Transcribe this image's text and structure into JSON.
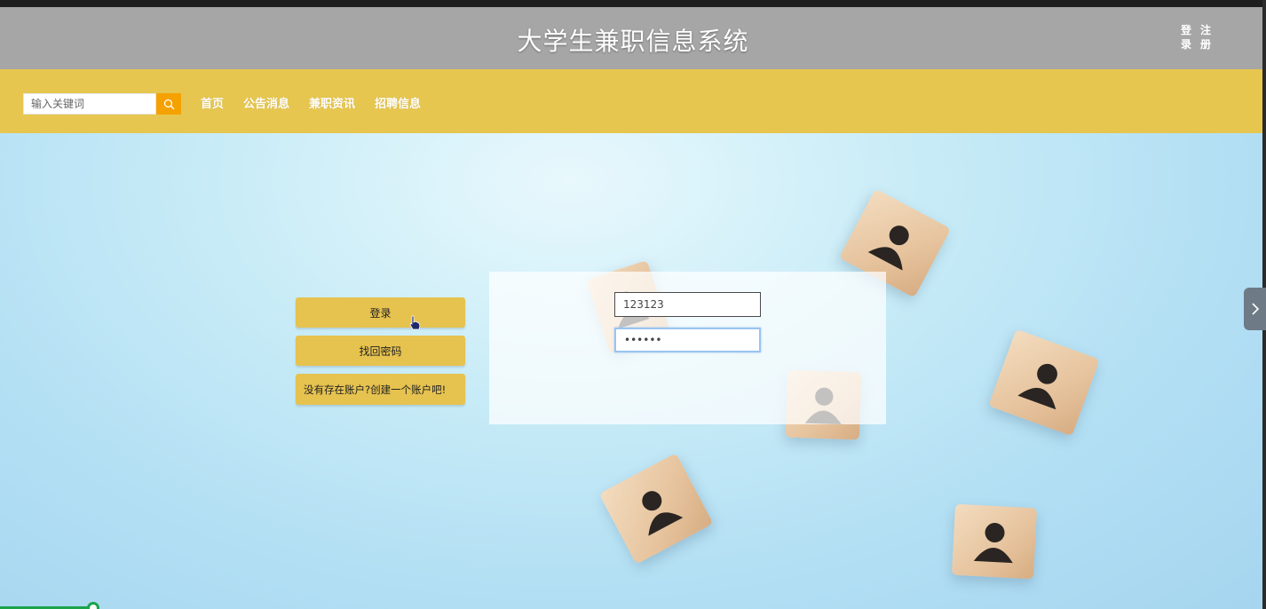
{
  "header": {
    "title": "大学生兼职信息系统",
    "login_link": "登录",
    "register_link": "注册"
  },
  "nav": {
    "search_placeholder": "输入关键词",
    "items": [
      "首页",
      "公告消息",
      "兼职资讯",
      "招聘信息"
    ]
  },
  "login": {
    "login_button": "登录",
    "forgot_button": "找回密码",
    "register_button": "没有存在账户?创建一个账户吧!",
    "username_value": "123123",
    "password_value": "123123"
  },
  "colors": {
    "header_bg": "#a6a6a7",
    "nav_bg": "#e6c64f",
    "search_button": "#f5a100",
    "button_bg": "#e6c24f"
  },
  "icons": [
    "search-icon",
    "chevron-right-icon",
    "person-icon",
    "cursor-hand-icon"
  ]
}
